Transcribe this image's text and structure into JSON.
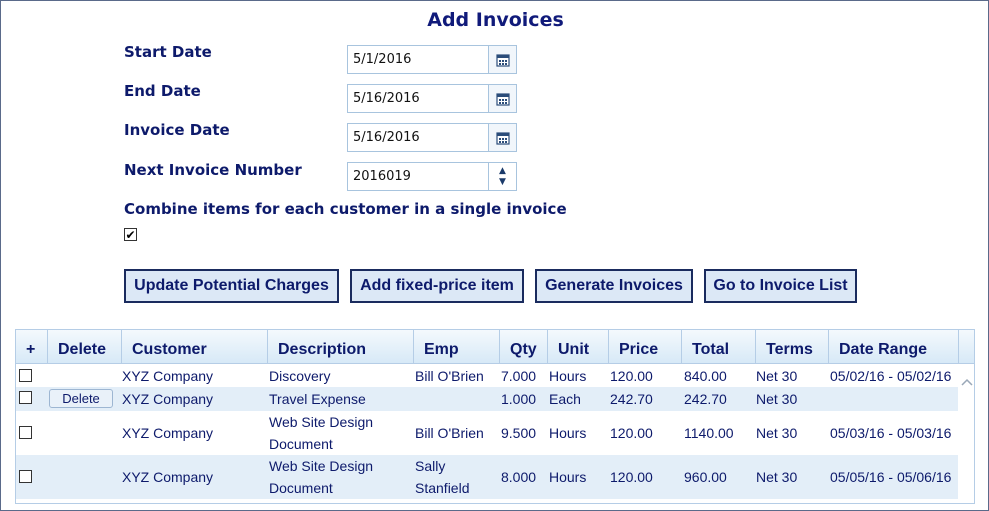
{
  "title": "Add Invoices",
  "form": {
    "start_date_label": "Start Date",
    "start_date_value": "5/1/2016",
    "end_date_label": "End Date",
    "end_date_value": "5/16/2016",
    "invoice_date_label": "Invoice Date",
    "invoice_date_value": "5/16/2016",
    "next_number_label": "Next Invoice Number",
    "next_number_value": "2016019",
    "combine_label": "Combine items for each customer in a single invoice",
    "combine_checked": true
  },
  "buttons": {
    "update": "Update Potential Charges",
    "add_fixed": "Add fixed-price item",
    "generate": "Generate Invoices",
    "go_list": "Go to Invoice List"
  },
  "grid": {
    "headers": {
      "plus": "+",
      "delete": "Delete",
      "customer": "Customer",
      "description": "Description",
      "emp": "Emp",
      "qty": "Qty",
      "unit": "Unit",
      "price": "Price",
      "total": "Total",
      "terms": "Terms",
      "date_range": "Date Range"
    },
    "rows": [
      {
        "customer": "XYZ Company",
        "description1": "Discovery",
        "description2": "",
        "emp1": "Bill O'Brien",
        "emp2": "",
        "qty": "7.000",
        "unit": "Hours",
        "price": "120.00",
        "total": "840.00",
        "terms": "Net 30",
        "date_range": "05/02/16 - 05/02/16",
        "delete_label": ""
      },
      {
        "customer": "XYZ Company",
        "description1": "Travel Expense",
        "description2": "",
        "emp1": "",
        "emp2": "",
        "qty": "1.000",
        "unit": "Each",
        "price": "242.70",
        "total": "242.70",
        "terms": "Net 30",
        "date_range": "",
        "delete_label": "Delete"
      },
      {
        "customer": "XYZ Company",
        "description1": "Web Site Design",
        "description2": "Document",
        "emp1": "Bill O'Brien",
        "emp2": "",
        "qty": "9.500",
        "unit": "Hours",
        "price": "120.00",
        "total": "1140.00",
        "terms": "Net 30",
        "date_range": "05/03/16 - 05/03/16",
        "delete_label": ""
      },
      {
        "customer": "XYZ Company",
        "description1": "Web Site Design",
        "description2": "Document",
        "emp1": "Sally",
        "emp2": "Stanfield",
        "qty": "8.000",
        "unit": "Hours",
        "price": "120.00",
        "total": "960.00",
        "terms": "Net 30",
        "date_range": "05/05/16 - 05/06/16",
        "delete_label": ""
      }
    ]
  },
  "icons": {
    "calendar": "calendar-icon",
    "spin_up": "▲",
    "spin_down": "▼",
    "check": "✔",
    "scroll_up": "︿"
  }
}
